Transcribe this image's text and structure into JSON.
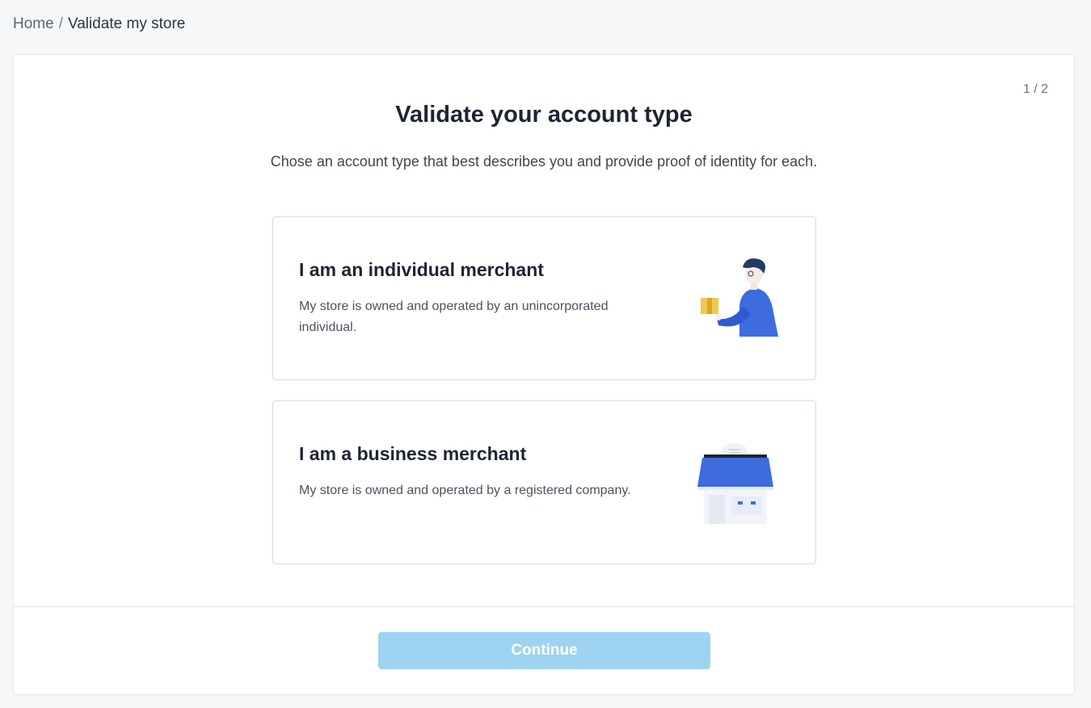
{
  "breadcrumb": {
    "home": "Home",
    "separator": "/",
    "current": "Validate my store"
  },
  "step": "1 / 2",
  "title": "Validate your account type",
  "subtitle": "Chose an account type that best describes you and provide proof of identity for each.",
  "options": [
    {
      "title": "I am an individual merchant",
      "description": "My store is owned and operated by an unincorporated individual.",
      "icon": "person-holding-box-illustration"
    },
    {
      "title": "I am a business merchant",
      "description": "My store is owned and operated by a registered company.",
      "icon": "storefront-illustration"
    }
  ],
  "continue_label": "Continue",
  "colors": {
    "accent": "#3d6be0",
    "button_disabled": "#9ed4f1",
    "box": "#f2c94c"
  }
}
